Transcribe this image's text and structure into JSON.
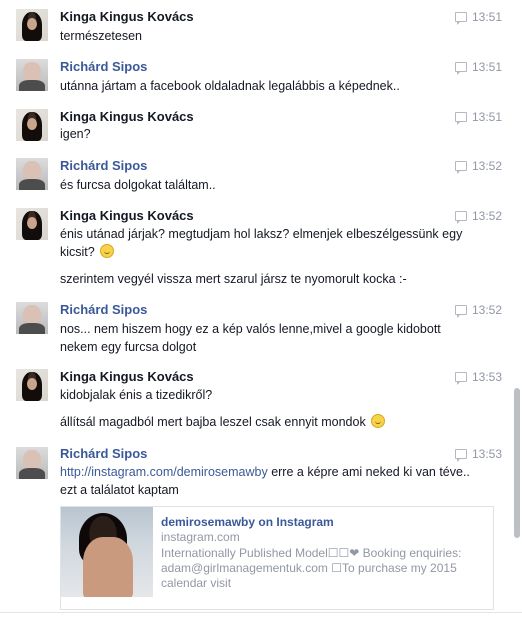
{
  "messages": [
    {
      "sender": "Kinga Kingus Kovács",
      "time": "13:51",
      "lines": [
        "természetesen"
      ]
    },
    {
      "sender": "Richárd Sipos",
      "time": "13:51",
      "lines": [
        "utánna jártam a facebook oldaladnak legalábbis a képednek.."
      ]
    },
    {
      "sender": "Kinga Kingus Kovács",
      "time": "13:51",
      "lines": [
        "igen?"
      ]
    },
    {
      "sender": "Richárd Sipos",
      "time": "13:52",
      "lines": [
        "és furcsa dolgokat találtam.."
      ]
    },
    {
      "sender": "Kinga Kingus Kovács",
      "time": "13:52",
      "lines": [
        "énis utánad járjak? megtudjam hol laksz? elmenjek elbeszélgessünk egy kicsit?",
        "szerintem vegyél vissza mert szarul jársz te nyomorult kocka :-"
      ]
    },
    {
      "sender": "Richárd Sipos",
      "time": "13:52",
      "lines": [
        "nos... nem hiszem hogy ez a kép valós lenne,mivel a google kidobott nekem egy furcsa dolgot"
      ]
    },
    {
      "sender": "Kinga Kingus Kovács",
      "time": "13:53",
      "lines": [
        "kidobjalak énis a tizedikről?",
        "állítsál magadból mert bajba leszel csak ennyit mondok"
      ]
    },
    {
      "sender": "Richárd Sipos",
      "time": "13:53",
      "link": "http://instagram.com/demirosemawby",
      "link_suffix": " erre a képre ami neked ki van téve.. ezt a találatot kaptam"
    }
  ],
  "share": {
    "title": "demirosemawby on Instagram",
    "domain": "instagram.com",
    "description": "Internationally Published Model☐☐❤ Booking enquiries: adam@girlmanagementuk.com ☐To purchase my 2015 calendar visit"
  },
  "icons": {
    "avatar_kinga": "avatar",
    "avatar_richard": "avatar",
    "time_icon": "message-icon",
    "smiley": "smiley-icon"
  },
  "colors": {
    "link": "#3b5998",
    "muted": "#9197a3",
    "text": "#141823"
  }
}
